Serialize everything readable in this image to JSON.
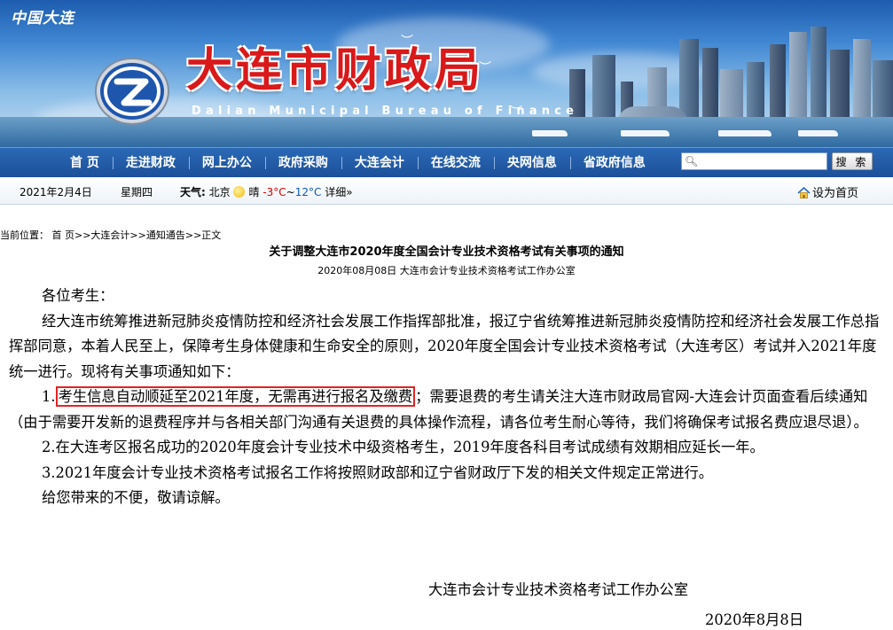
{
  "header": {
    "site_mark": "中国大连",
    "title_cn": "大连市财政局",
    "title_en": "Dalian Municipal Bureau of Finance"
  },
  "nav": {
    "items": [
      "首 页",
      "走进财政",
      "网上办公",
      "政府采购",
      "大连会计",
      "在线交流",
      "央网信息",
      "省政府信息"
    ]
  },
  "search": {
    "placeholder": "",
    "button_label": "搜 索"
  },
  "infobar": {
    "date": "2021年2月4日",
    "weekday": "星期四",
    "weather_label": "天气:",
    "city": "北京",
    "condition": "晴",
    "temp_low": "-3°C",
    "temp_sep": "~",
    "temp_high": "12°C",
    "details": "详细»",
    "set_home": "设为首页"
  },
  "breadcrumb": "当前位置： 首 页>>大连会计>>通知通告>>正文",
  "article": {
    "title": "关于调整大连市2020年度全国会计专业技术资格考试有关事项的通知",
    "meta": "2020年08月08日  大连市会计专业技术资格考试工作办公室",
    "salutation": "各位考生：",
    "intro": "经大连市统筹推进新冠肺炎疫情防控和经济社会发展工作指挥部批准，报辽宁省统筹推进新冠肺炎疫情防控和经济社会发展工作总指挥部同意，本着人民至上，保障考生身体健康和生命安全的原则，2020年度全国会计专业技术资格考试（大连考区）考试并入2021年度统一进行。现将有关事项通知如下：",
    "item1_num": "1.",
    "item1_highlight": "考生信息自动顺延至2021年度，无需再进行报名及缴费",
    "item1_rest": "；需要退费的考生请关注大连市财政局官网-大连会计页面查看后续通知（由于需要开发新的退费程序并与各相关部门沟通有关退费的具体操作流程，请各位考生耐心等待，我们将确保考试报名费应退尽退）。",
    "item2": "2.在大连考区报名成功的2020年度会计专业技术中级资格考生，2019年度各科目考试成绩有效期相应延长一年。",
    "item3": "3.2021年度会计专业技术资格考试报名工作将按照财政部和辽宁省财政厅下发的相关文件规定正常进行。",
    "closing": "给您带来的不便，敬请谅解。",
    "signature": "大连市会计专业技术资格考试工作办公室",
    "date": "2020年8月8日"
  },
  "colors": {
    "nav_bg": "#1c4f98",
    "title_red": "#d9191a",
    "highlight_border": "#e32222"
  }
}
